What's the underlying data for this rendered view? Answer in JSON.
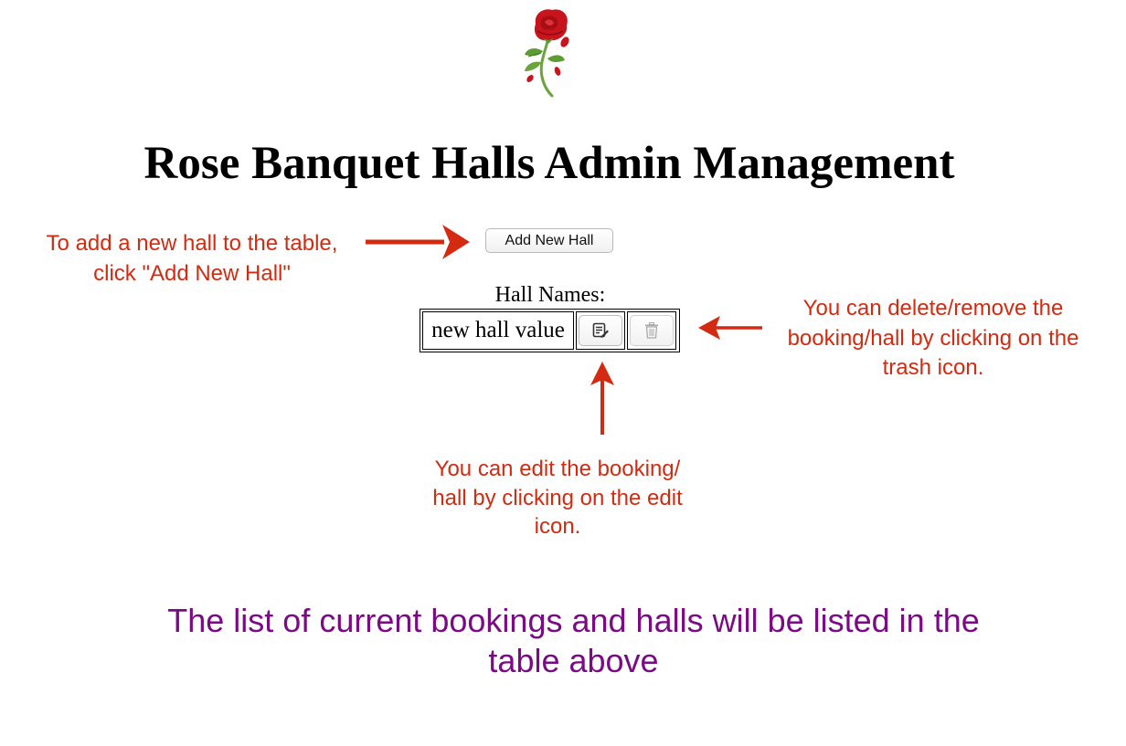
{
  "header": {
    "logo_icon": "rose-icon",
    "title": "Rose Banquet Halls Admin Management"
  },
  "toolbar": {
    "add_hall_label": "Add New Hall"
  },
  "hall_table": {
    "caption": "Hall Names:",
    "rows": [
      {
        "name": "new hall value",
        "edit_icon": "edit-icon",
        "delete_icon": "trash-icon",
        "delete_enabled": false
      }
    ]
  },
  "annotations": {
    "add_note": "To add a new hall to the table, click \"Add New Hall\"",
    "delete_note": "You can delete/remove the booking/hall by clicking on the trash icon.",
    "edit_note": "You can edit the booking/ hall by clicking on the edit icon.",
    "footer_note": "The list of current bookings and halls will be listed in the table above"
  },
  "colors": {
    "annotation": "#d32a10",
    "arrow": "#d42a12",
    "footer": "#7b0a85",
    "rose": "#c8141c",
    "stem": "#6aa43c"
  }
}
